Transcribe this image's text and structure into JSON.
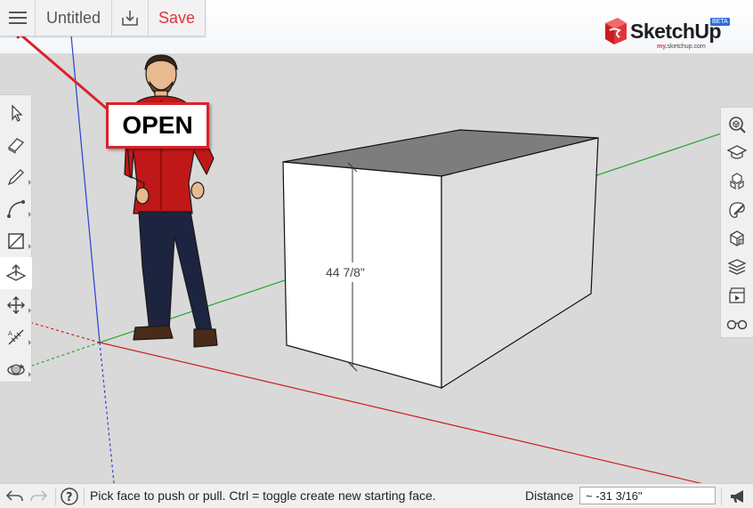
{
  "toolbar": {
    "document_title": "Untitled",
    "save_label": "Save",
    "menu_icon": "hamburger-menu-icon",
    "download_icon": "download-icon"
  },
  "logo": {
    "word": "SketchUp",
    "badge": "BETA",
    "sub_prefix": "my.",
    "sub_rest": "sketchup.com"
  },
  "annotation": {
    "label": "OPEN",
    "color": "#d8232a"
  },
  "model": {
    "dimension_label": "44 7/8\""
  },
  "left_tools": [
    {
      "icon": "select-arrow-icon"
    },
    {
      "icon": "eraser-icon"
    },
    {
      "icon": "pencil-line-icon"
    },
    {
      "icon": "arc-icon"
    },
    {
      "icon": "rectangle-icon"
    },
    {
      "icon": "push-pull-icon",
      "active": true
    },
    {
      "icon": "move-icon"
    },
    {
      "icon": "tape-measure-icon"
    },
    {
      "icon": "orbit-icon"
    }
  ],
  "right_tools": [
    {
      "icon": "search-3d-warehouse-icon"
    },
    {
      "icon": "instructor-icon"
    },
    {
      "icon": "components-icon"
    },
    {
      "icon": "materials-icon"
    },
    {
      "icon": "styles-icon"
    },
    {
      "icon": "layers-icon"
    },
    {
      "icon": "scenes-icon"
    },
    {
      "icon": "display-glasses-icon"
    }
  ],
  "status": {
    "message": "Pick face to push or pull. Ctrl = toggle create new starting face.",
    "distance_label": "Distance",
    "distance_value": "~ -31 3/16\"",
    "undo_icon": "undo-icon",
    "redo_icon": "redo-icon",
    "help_icon": "help-icon",
    "feedback_icon": "megaphone-icon"
  },
  "colors": {
    "accent": "#e0353b",
    "axis_red": "#cc1f1f",
    "axis_green": "#29a329",
    "axis_blue": "#2a3fd6",
    "ground": "#d9d9d9"
  }
}
